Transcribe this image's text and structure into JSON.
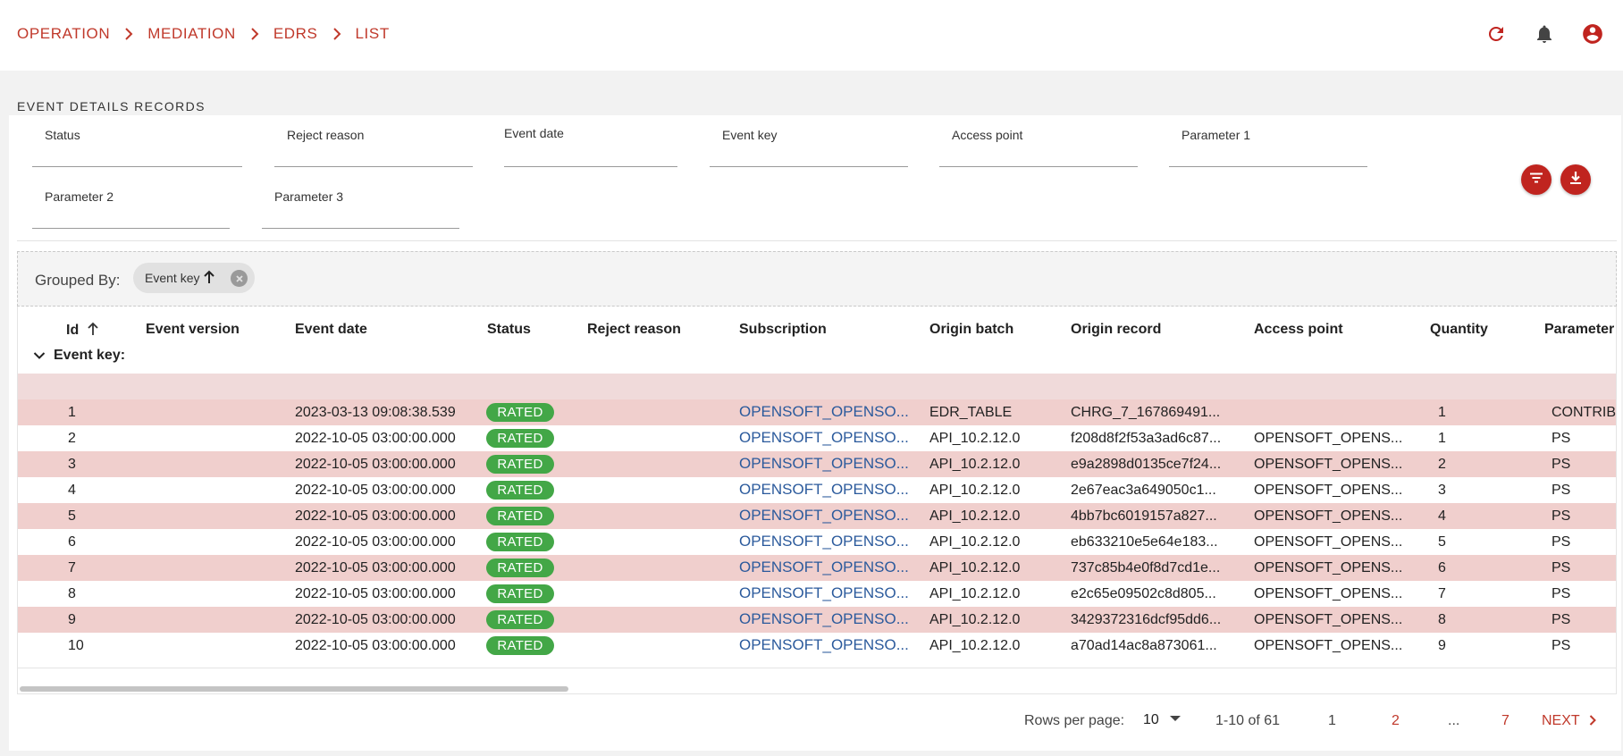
{
  "breadcrumb": [
    "OPERATION",
    "MEDIATION",
    "EDRS",
    "LIST"
  ],
  "header_icons": [
    "refresh-icon",
    "bell-icon",
    "account-circle-icon"
  ],
  "page_title": "EVENT DETAILS RECORDS",
  "filters": {
    "status": "Status",
    "reject_reason": "Reject reason",
    "event_date": "Event date",
    "event_key": "Event key",
    "access_point": "Access point",
    "parameter_1": "Parameter 1",
    "parameter_2": "Parameter 2",
    "parameter_3": "Parameter 3"
  },
  "actions": [
    "filter-icon",
    "download-icon"
  ],
  "grouping": {
    "label": "Grouped By:",
    "chip": "Event key",
    "chip_sort": "ascending"
  },
  "columns": [
    "Id",
    "Event version",
    "Event date",
    "Status",
    "Reject reason",
    "Subscription",
    "Origin batch",
    "Origin record",
    "Access point",
    "Quantity",
    "Parameter"
  ],
  "group_header": "Event key:",
  "rows": [
    {
      "id": "1",
      "version": "",
      "date": "2023-03-13 09:08:38.539",
      "status": "RATED",
      "reject": "",
      "subscription": "OPENSOFT_OPENSO...",
      "batch": "EDR_TABLE",
      "record": "CHRG_7_167869491...",
      "access_point": "",
      "quantity": "1",
      "parameter": "CONTRIB"
    },
    {
      "id": "2",
      "version": "",
      "date": "2022-10-05 03:00:00.000",
      "status": "RATED",
      "reject": "",
      "subscription": "OPENSOFT_OPENSO...",
      "batch": "API_10.2.12.0",
      "record": "f208d8f2f53a3ad6c87...",
      "access_point": "OPENSOFT_OPENS...",
      "quantity": "1",
      "parameter": "PS"
    },
    {
      "id": "3",
      "version": "",
      "date": "2022-10-05 03:00:00.000",
      "status": "RATED",
      "reject": "",
      "subscription": "OPENSOFT_OPENSO...",
      "batch": "API_10.2.12.0",
      "record": "e9a2898d0135ce7f24...",
      "access_point": "OPENSOFT_OPENS...",
      "quantity": "2",
      "parameter": "PS"
    },
    {
      "id": "4",
      "version": "",
      "date": "2022-10-05 03:00:00.000",
      "status": "RATED",
      "reject": "",
      "subscription": "OPENSOFT_OPENSO...",
      "batch": "API_10.2.12.0",
      "record": "2e67eac3a649050c1...",
      "access_point": "OPENSOFT_OPENS...",
      "quantity": "3",
      "parameter": "PS"
    },
    {
      "id": "5",
      "version": "",
      "date": "2022-10-05 03:00:00.000",
      "status": "RATED",
      "reject": "",
      "subscription": "OPENSOFT_OPENSO...",
      "batch": "API_10.2.12.0",
      "record": "4bb7bc6019157a827...",
      "access_point": "OPENSOFT_OPENS...",
      "quantity": "4",
      "parameter": "PS"
    },
    {
      "id": "6",
      "version": "",
      "date": "2022-10-05 03:00:00.000",
      "status": "RATED",
      "reject": "",
      "subscription": "OPENSOFT_OPENSO...",
      "batch": "API_10.2.12.0",
      "record": "eb633210e5e64e183...",
      "access_point": "OPENSOFT_OPENS...",
      "quantity": "5",
      "parameter": "PS"
    },
    {
      "id": "7",
      "version": "",
      "date": "2022-10-05 03:00:00.000",
      "status": "RATED",
      "reject": "",
      "subscription": "OPENSOFT_OPENSO...",
      "batch": "API_10.2.12.0",
      "record": "737c85b4e0f8d7cd1e...",
      "access_point": "OPENSOFT_OPENS...",
      "quantity": "6",
      "parameter": "PS"
    },
    {
      "id": "8",
      "version": "",
      "date": "2022-10-05 03:00:00.000",
      "status": "RATED",
      "reject": "",
      "subscription": "OPENSOFT_OPENSO...",
      "batch": "API_10.2.12.0",
      "record": "e2c65e09502c8d805...",
      "access_point": "OPENSOFT_OPENS...",
      "quantity": "7",
      "parameter": "PS"
    },
    {
      "id": "9",
      "version": "",
      "date": "2022-10-05 03:00:00.000",
      "status": "RATED",
      "reject": "",
      "subscription": "OPENSOFT_OPENSO...",
      "batch": "API_10.2.12.0",
      "record": "3429372316dcf95dd6...",
      "access_point": "OPENSOFT_OPENS...",
      "quantity": "8",
      "parameter": "PS"
    },
    {
      "id": "10",
      "version": "",
      "date": "2022-10-05 03:00:00.000",
      "status": "RATED",
      "reject": "",
      "subscription": "OPENSOFT_OPENSO...",
      "batch": "API_10.2.12.0",
      "record": "a70ad14ac8a873061...",
      "access_point": "OPENSOFT_OPENS...",
      "quantity": "9",
      "parameter": "PS"
    }
  ],
  "pagination": {
    "rows_per_page_label": "Rows per page:",
    "rows_per_page": "10",
    "range": "1-10 of 61",
    "pages": [
      "1",
      "2",
      "...",
      "7"
    ],
    "next": "NEXT"
  },
  "colors": {
    "accent": "#c0392b",
    "fab": "#c0241f",
    "row_highlight": "#f0cfcd",
    "status_rated": "#43a747",
    "link": "#2b5a9c"
  }
}
